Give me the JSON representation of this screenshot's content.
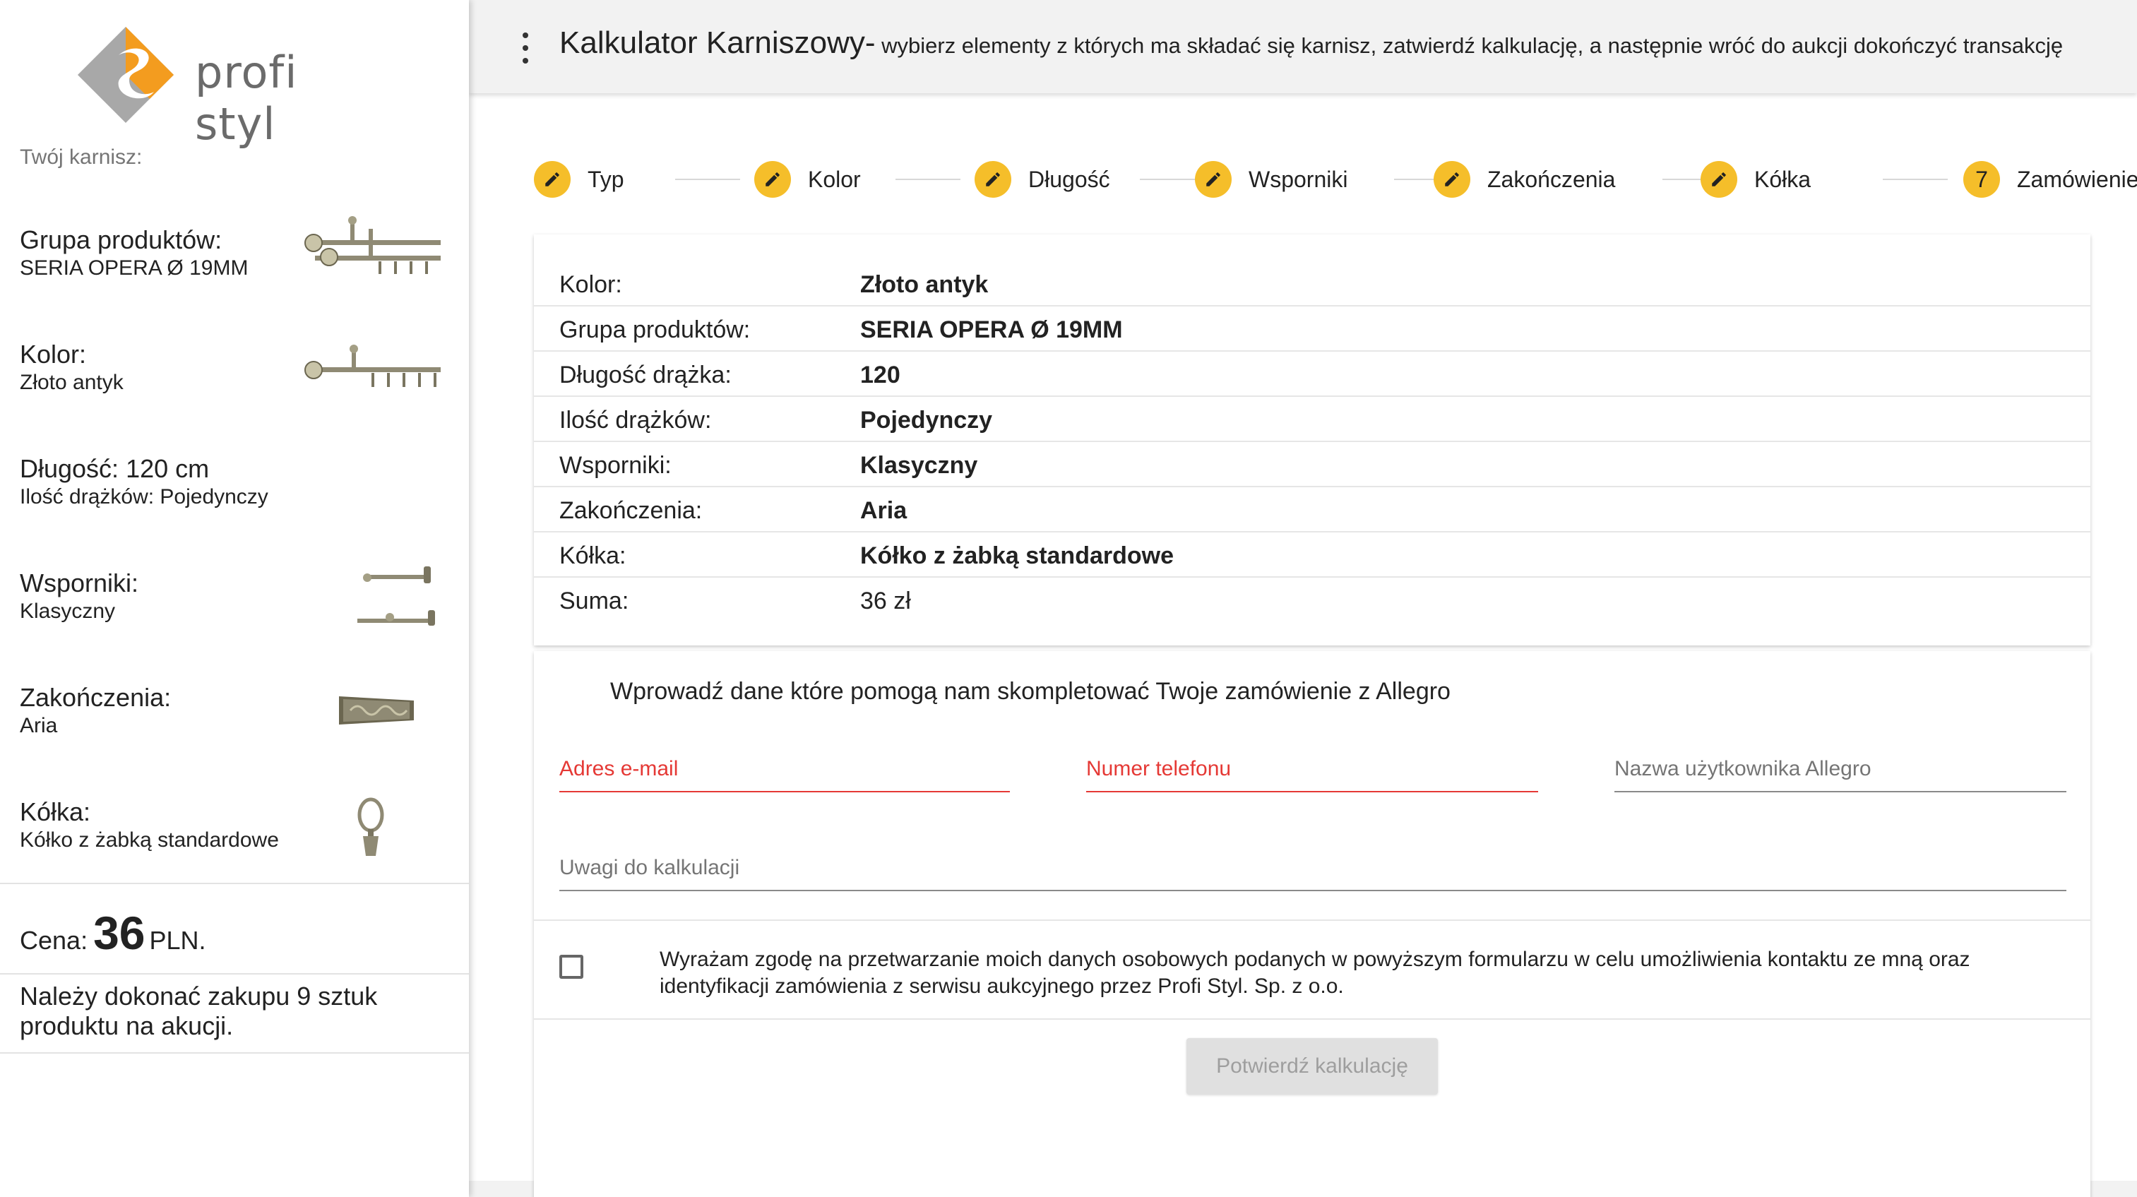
{
  "brand": {
    "name": "profi styl"
  },
  "sidebar": {
    "heading": "Twój karnisz:",
    "items": [
      {
        "title": "Grupa produktów:",
        "value": "SERIA OPERA Ø 19MM"
      },
      {
        "title": "Kolor:",
        "value": "Złoto antyk"
      },
      {
        "title": "Długość: 120 cm",
        "value": "Ilość drążków: Pojedynczy"
      },
      {
        "title": "Wsporniki:",
        "value": "Klasyczny"
      },
      {
        "title": "Zakończenia:",
        "value": "Aria"
      },
      {
        "title": "Kółka:",
        "value": "Kółko z żabką standardowe"
      }
    ],
    "price_label": "Cena:",
    "price_value": "36",
    "price_currency": "PLN.",
    "notice": "Należy dokonać zakupu 9 sztuk produktu na akucji."
  },
  "header": {
    "title": "Kalkulator Karniszowy-",
    "subtitle": " wybierz elementy z których ma składać się karnisz, zatwierdź kalkulację, a następnie wróć do aukcji dokończyć transakcję"
  },
  "steps": [
    {
      "label": "Typ",
      "icon": "pencil-icon"
    },
    {
      "label": "Kolor",
      "icon": "pencil-icon"
    },
    {
      "label": "Długość",
      "icon": "pencil-icon"
    },
    {
      "label": "Wsporniki",
      "icon": "pencil-icon"
    },
    {
      "label": "Zakończenia",
      "icon": "pencil-icon"
    },
    {
      "label": "Kółka",
      "icon": "pencil-icon"
    },
    {
      "label": "Zamówienie",
      "number": "7"
    }
  ],
  "summary": [
    {
      "key": "Kolor:",
      "value": "Złoto antyk"
    },
    {
      "key": "Grupa produktów:",
      "value": "SERIA OPERA Ø 19MM"
    },
    {
      "key": "Długość drążka:",
      "value": "120"
    },
    {
      "key": "Ilość drążków:",
      "value": "Pojedynczy"
    },
    {
      "key": "Wsporniki:",
      "value": "Klasyczny"
    },
    {
      "key": "Zakończenia:",
      "value": "Aria"
    },
    {
      "key": "Kółka:",
      "value": "Kółko z żabką standardowe"
    },
    {
      "key": "Suma:",
      "value": "36 zł"
    }
  ],
  "form": {
    "intro": "Wprowadź dane które pomogą nam skompletować Twoje zamówienie z Allegro",
    "email_label": "Adres e-mail",
    "phone_label": "Numer telefonu",
    "allegro_label": "Nazwa użytkownika Allegro",
    "notes_label": "Uwagi do kalkulacji",
    "consent": "Wyrażam zgodę na przetwarzanie moich danych osobowych podanych w powyższym formularzu w celu umożliwienia kontaktu ze mną oraz identyfikacji zamówienia z serwisu aukcyjnego przez Profi Styl. Sp. z o.o.",
    "confirm_label": "Potwierdź kalkulację"
  },
  "colors": {
    "accent": "#f5be2a",
    "error": "#e53935",
    "disabled_bg": "#e0e0e0",
    "disabled_text": "#9e9e9e"
  }
}
